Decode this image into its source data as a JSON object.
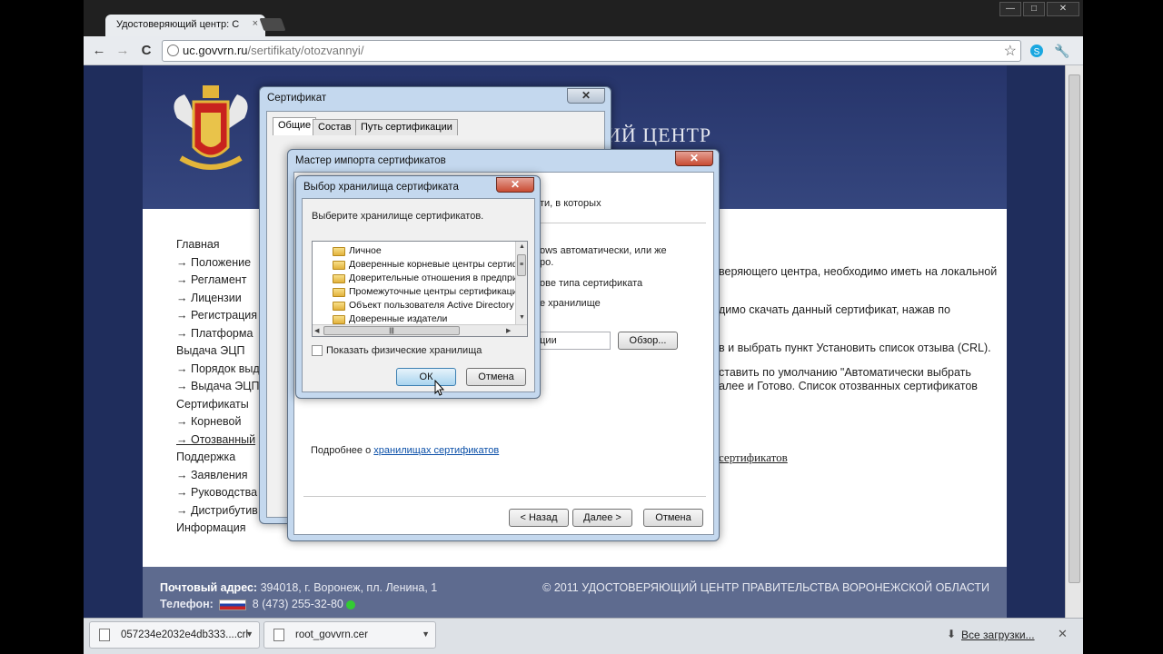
{
  "browser": {
    "tab_title": "Удостоверяющий центр: С",
    "tab_close": "×",
    "url_host": "uc.govvrn.ru",
    "url_path": "/sertifikaty/otozvannyi/",
    "back": "←",
    "forward": "→",
    "reload": "C",
    "star": "☆",
    "wrench": "🔧",
    "win_min": "—",
    "win_max": "□",
    "win_close": "✕",
    "icons": [
      "back-arrow-icon",
      "forward-arrow-icon",
      "reload-icon",
      "globe-icon",
      "star-icon",
      "skype-icon",
      "wrench-icon"
    ]
  },
  "site": {
    "header_title": "ИЙ ЦЕНТР",
    "nav": [
      {
        "label": "Главная",
        "sub": false
      },
      {
        "label": "Положение",
        "sub": true
      },
      {
        "label": "Регламент",
        "sub": true
      },
      {
        "label": "Лицензии",
        "sub": true
      },
      {
        "label": "Регистрация",
        "sub": true
      },
      {
        "label": "Платформа",
        "sub": true
      },
      {
        "label": "Выдача ЭЦП",
        "sub": false
      },
      {
        "label": "Порядок выд",
        "sub": true
      },
      {
        "label": "Выдача ЭЦП",
        "sub": true
      },
      {
        "label": "Сертификаты",
        "sub": false
      },
      {
        "label": "Корневой",
        "sub": true
      },
      {
        "label": "Отозванный",
        "sub": true,
        "active": true
      },
      {
        "label": "Поддержка",
        "sub": false
      },
      {
        "label": "Заявления",
        "sub": true
      },
      {
        "label": "Руководства",
        "sub": true
      },
      {
        "label": "Дистрибутив",
        "sub": true
      },
      {
        "label": "Информация",
        "sub": false
      }
    ],
    "content": {
      "line1": "веряющего центра, необходимо иметь на локальной",
      "line2": "димо скачать данный сертификат, нажав по",
      "line3": "в и выбрать пункт Установить список отзыва (CRL).",
      "line4": "ставить по умолчанию \"Автоматически выбрать",
      "line5": "алее и Готово. Список отозванных сертификатов",
      "line6": "сертификатов"
    },
    "footer": {
      "addr_label": "Почтовый адрес:",
      "addr_value": " 394018, г. Воронеж, пл. Ленина, 1",
      "phone_label": "Телефон:",
      "phone_value": "8 (473) 255-32-80",
      "copyright": "© 2011 УДОСТОВЕРЯЮЩИЙ ЦЕНТР ПРАВИТЕЛЬСТВА ВОРОНЕЖСКОЙ ОБЛАСТИ"
    }
  },
  "cert_dialog": {
    "title": "Сертификат",
    "close": "✕",
    "tabs": [
      "Общие",
      "Состав",
      "Путь сертификации"
    ]
  },
  "wizard": {
    "title": "Мастер импорта сертификатов",
    "close": "✕",
    "text1": "ти, в которых",
    "text2": "ows автоматически, или же",
    "text3": "ро.",
    "text4": "ове типа сертификата",
    "text5": "е хранилище",
    "field_value": "ации",
    "browse": "Обзор...",
    "more_prefix": "Подробнее о ",
    "more_link": "хранилищах сертификатов",
    "back": "< Назад",
    "next": "Далее >",
    "cancel": "Отмена"
  },
  "store_dialog": {
    "title": "Выбор хранилища сертификата",
    "close": "✕",
    "prompt": "Выберите хранилище сертификатов.",
    "items": [
      "Личное",
      "Доверенные корневые центры сертиф",
      "Доверительные отношения в предпри",
      "Промежуточные центры сертификаци",
      "Объект пользователя Active Directory",
      "Доверенные издатели"
    ],
    "hscroll_grip": "|||",
    "vscroll_grip": "≡",
    "checkbox_label": "Показать физические хранилища",
    "ok": "ОК",
    "cancel": "Отмена"
  },
  "downloads": {
    "item1": "057234e2032e4db333....crl",
    "item2": "root_govvrn.cer",
    "all": "Все загрузки...",
    "close": "✕"
  }
}
